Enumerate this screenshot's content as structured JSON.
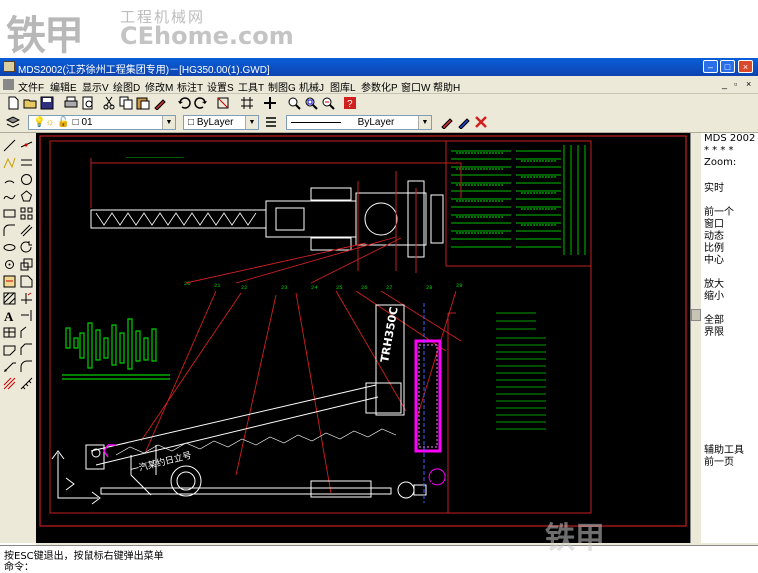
{
  "watermark": {
    "brand": "铁甲",
    "site_cn": "工程机械网",
    "site_en": "CEhome.com"
  },
  "window": {
    "title": "MDS2002(江苏徐州工程集团专用)－[HG350.00(1).GWD]"
  },
  "menu": [
    "文件F",
    "编辑E",
    "显示V",
    "绘图D",
    "修改M",
    "标注T",
    "设置S",
    "工具T",
    "制图G",
    "机械J",
    "图库L",
    "参数化P",
    "窗口W",
    "帮助H"
  ],
  "layer_toolbar": {
    "layer_name": "01",
    "color": "ByLayer",
    "linetype": "ByLayer"
  },
  "right_panel": {
    "header": [
      "MDS 2002",
      "* * * *",
      "Zoom:"
    ],
    "items": [
      "实时",
      "前一个",
      "窗口",
      "动态",
      "比例",
      "中心",
      "放大",
      "缩小",
      "全部",
      "界限"
    ],
    "footer": [
      "辅助工具",
      "前一页"
    ]
  },
  "drawing": {
    "crane_label": "TRH350C",
    "boom_text": "一汽某约日立号",
    "dim_labels": [
      "20",
      "21",
      "22",
      "23",
      "24",
      "25",
      "26",
      "27",
      "28",
      "29",
      "30",
      "31",
      "32",
      "33",
      "34",
      "35",
      "36",
      "37"
    ]
  },
  "command": {
    "line1": "按ESC键退出，按鼠标右键弹出菜单",
    "prompt": "命令："
  },
  "colors": {
    "canvas": "#000000",
    "frame": "#d02020",
    "drawing": "#ffffff",
    "text": "#00e000",
    "highlight": "#ff00ff"
  }
}
